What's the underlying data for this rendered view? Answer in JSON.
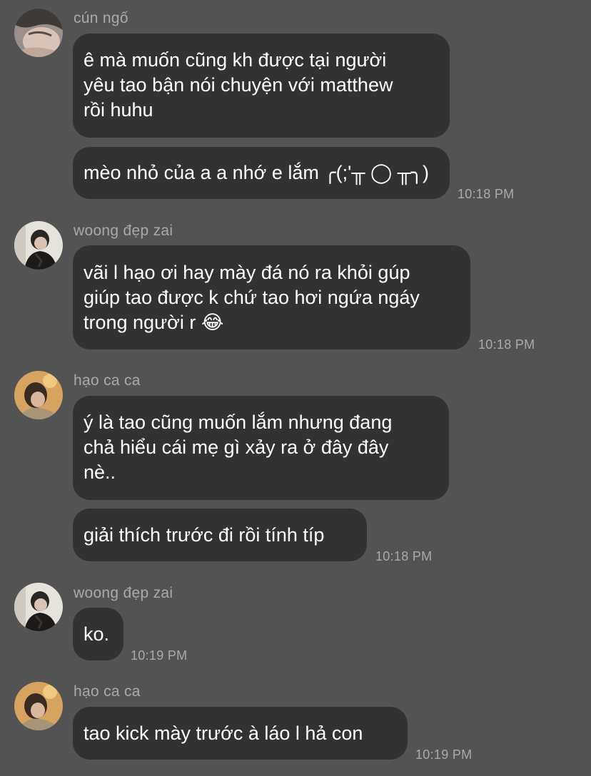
{
  "messages": [
    {
      "sender": "cún ngố",
      "bubbles": [
        {
          "lines": [
            "ê mà muốn cũng kh được tại người",
            "yêu tao bận nói chuyện với matthew",
            "rồi huhu"
          ]
        },
        {
          "lines": [
            "mèo nhỏ của a a nhớ e lắm ╭(;'╥ ◯ ╥╮)"
          ],
          "time": "10:18 PM"
        }
      ]
    },
    {
      "sender": "woong đẹp zai",
      "bubbles": [
        {
          "lines": [
            "vãi l hạo ơi hay mày đá nó ra khỏi gúp",
            "giúp tao được k chứ tao hơi ngứa ngáy",
            "trong người r 😂"
          ],
          "time": "10:18 PM"
        }
      ]
    },
    {
      "sender": "hạo ca ca",
      "bubbles": [
        {
          "lines": [
            "ý là tao cũng muốn lắm nhưng đang",
            "chả hiểu cái mẹ gì xảy ra ở đây đây",
            "nè.."
          ]
        },
        {
          "lines": [
            "giải thích trước đi rồi tính típ"
          ],
          "time": "10:18 PM"
        }
      ]
    },
    {
      "sender": "woong đẹp zai",
      "bubbles": [
        {
          "lines": [
            "ko."
          ],
          "time": "10:19 PM"
        }
      ]
    },
    {
      "sender": "hạo ca ca",
      "bubbles": [
        {
          "lines": [
            "tao kick mày trước à láo l hả con"
          ],
          "time": "10:19 PM"
        }
      ]
    }
  ]
}
